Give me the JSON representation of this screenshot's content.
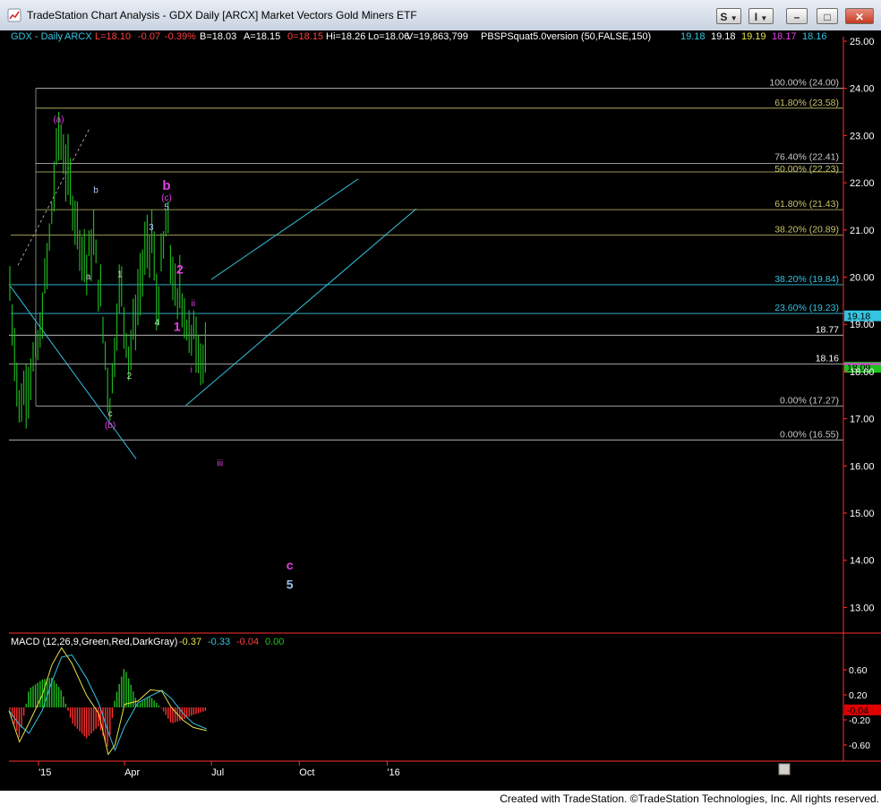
{
  "window": {
    "title": "TradeStation Chart Analysis - GDX Daily [ARCX] Market Vectors Gold Miners ETF",
    "btn_s": "S",
    "btn_i": "I"
  },
  "header": {
    "symbol": "GDX - Daily",
    "exchange": "ARCX",
    "last": "L=18.10",
    "change": "-0.07",
    "change_pct": "-0.39%",
    "bid": "B=18.03",
    "ask": "A=18.15",
    "prev": "0=18.15",
    "high": "Hi=18.26",
    "low": "Lo=18.06",
    "volume": "V=19,863,799",
    "study": "PBSPSquat5.0version (50,FALSE,150)",
    "study_values": [
      "19.18",
      "19.18",
      "19.19",
      "18.17",
      "18.16"
    ],
    "study_colors": [
      "#34c3e0",
      "#ffffff",
      "#e6e24a",
      "#e43fe4",
      "#34c3e0"
    ]
  },
  "colors": {
    "up": "#ff4040",
    "down": "#ff4040",
    "bars": "#20c020",
    "magenta": "#e43fe4",
    "cyan": "#34c3e0",
    "fib_gray": "#c8c8c8",
    "fib_olive": "#c8c46a"
  },
  "chart_data": {
    "type": "line",
    "symbol": "GDX",
    "price_axis": {
      "ticks": [
        "25.00",
        "24.00",
        "23.00",
        "22.00",
        "21.00",
        "20.00",
        "19.00",
        "18.00",
        "17.00",
        "16.00",
        "15.00",
        "14.00",
        "13.00"
      ],
      "ylim": [
        12.5,
        25.1
      ]
    },
    "time_axis": {
      "ticks": [
        "'15",
        "Apr",
        "Jul",
        "Oct",
        "'16"
      ]
    },
    "price_series": [
      {
        "t": "2014-12-01",
        "v": 20.0
      },
      {
        "t": "2014-12-12",
        "v": 17.2
      },
      {
        "t": "2014-12-20",
        "v": 17.8
      },
      {
        "t": "2015-01-02",
        "v": 18.6
      },
      {
        "t": "2015-01-12",
        "v": 20.7
      },
      {
        "t": "2015-01-22",
        "v": 23.1
      },
      {
        "t": "2015-01-30",
        "v": 22.3
      },
      {
        "t": "2015-02-10",
        "v": 21.2
      },
      {
        "t": "2015-02-20",
        "v": 20.2
      },
      {
        "t": "2015-02-27",
        "v": 20.8
      },
      {
        "t": "2015-03-05",
        "v": 19.9
      },
      {
        "t": "2015-03-17",
        "v": 17.3
      },
      {
        "t": "2015-03-27",
        "v": 19.9
      },
      {
        "t": "2015-04-06",
        "v": 18.3
      },
      {
        "t": "2015-04-20",
        "v": 20.2
      },
      {
        "t": "2015-04-30",
        "v": 20.9
      },
      {
        "t": "2015-05-05",
        "v": 19.3
      },
      {
        "t": "2015-05-15",
        "v": 21.2
      },
      {
        "t": "2015-05-26",
        "v": 19.2
      },
      {
        "t": "2015-05-29",
        "v": 19.9
      },
      {
        "t": "2015-06-05",
        "v": 19.0
      },
      {
        "t": "2015-06-10",
        "v": 18.5
      },
      {
        "t": "2015-06-12",
        "v": 19.1
      },
      {
        "t": "2015-06-19",
        "v": 18.4
      },
      {
        "t": "2015-06-26",
        "v": 18.1
      }
    ],
    "fib_levels": [
      {
        "label": "100.00% (24.00)",
        "value": 24.0,
        "color": "gray"
      },
      {
        "label": "61.80% (23.58)",
        "value": 23.58,
        "color": "olive"
      },
      {
        "label": "76.40% (22.41)",
        "value": 22.41,
        "color": "gray"
      },
      {
        "label": "50.00% (22.23)",
        "value": 22.23,
        "color": "olive"
      },
      {
        "label": "61.80% (21.43)",
        "value": 21.43,
        "color": "olive"
      },
      {
        "label": "38.20% (20.89)",
        "value": 20.89,
        "color": "olive"
      },
      {
        "label": "38.20% (19.84)",
        "value": 19.84,
        "color": "cyan"
      },
      {
        "label": "23.60% (19.23)",
        "value": 19.23,
        "color": "cyan"
      },
      {
        "label": "0.00% (17.27)",
        "value": 17.27,
        "color": "gray"
      },
      {
        "label": "0.00% (16.55)",
        "value": 16.55,
        "color": "gray"
      }
    ],
    "price_lines": [
      {
        "label": "18.77",
        "value": 18.77
      },
      {
        "label": "18.16",
        "value": 18.16
      }
    ],
    "price_markers": [
      {
        "label": "19.18",
        "value": 19.18,
        "bg": "#34c3e0",
        "fg": "#000000"
      },
      {
        "label": "18.09",
        "value": 18.09,
        "bg": "#20c020",
        "fg": "#000000"
      }
    ],
    "wave_labels": [
      {
        "text": "(a)",
        "t": "2015-01-22",
        "v": 23.28,
        "color": "magenta"
      },
      {
        "text": "b",
        "t": "2015-03-02",
        "v": 21.78,
        "color": "cyan"
      },
      {
        "text": "a",
        "t": "2015-02-22",
        "v": 19.95,
        "color": "gray"
      },
      {
        "text": "c",
        "t": "2015-03-17",
        "v": 17.05,
        "color": "gray"
      },
      {
        "text": "(b)",
        "t": "2015-03-17",
        "v": 16.8,
        "color": "magenta"
      },
      {
        "text": "1",
        "t": "2015-03-27",
        "v": 20.0,
        "color": "gray"
      },
      {
        "text": "2",
        "t": "2015-04-06",
        "v": 17.85,
        "color": "gray"
      },
      {
        "text": "3",
        "t": "2015-04-29",
        "v": 21.0,
        "color": "cyan"
      },
      {
        "text": "4",
        "t": "2015-05-05",
        "v": 18.98,
        "color": "gray"
      },
      {
        "text": "5",
        "t": "2015-05-15",
        "v": 21.42,
        "color": "cyan"
      },
      {
        "text": "(c)",
        "t": "2015-05-15",
        "v": 21.62,
        "color": "magenta"
      },
      {
        "text": "b",
        "t": "2015-05-15",
        "v": 21.85,
        "color": "magenta_big"
      },
      {
        "text": "2",
        "t": "2015-05-29",
        "v": 20.08,
        "color": "magenta_big"
      },
      {
        "text": "1",
        "t": "2015-05-26",
        "v": 18.86,
        "color": "magenta_big"
      },
      {
        "text": "ii",
        "t": "2015-06-12",
        "v": 19.38,
        "color": "magenta"
      },
      {
        "text": "i",
        "t": "2015-06-10",
        "v": 17.98,
        "color": "magenta"
      },
      {
        "text": "iii",
        "t": "2015-07-10",
        "v": 16.0,
        "color": "magenta"
      },
      {
        "text": "c",
        "t": "2015-09-21",
        "v": 13.8,
        "color": "magenta_big"
      },
      {
        "text": "5",
        "t": "2015-09-21",
        "v": 13.4,
        "color": "cyan_big"
      }
    ],
    "macd": {
      "title": "MACD (12,26,9,Green,Red,DarkGray)",
      "values": [
        "-0.37",
        "-0.33",
        "-0.04",
        "0.00"
      ],
      "value_colors": [
        "#e6e24a",
        "#34c3e0",
        "#ff4040",
        "#20c020"
      ],
      "ticks": [
        "0.60",
        "0.20",
        "-0.20",
        "-0.60"
      ],
      "ylim": [
        -0.85,
        0.95
      ],
      "marker": "-0.04"
    }
  },
  "footer": {
    "credit": "Created with TradeStation. ©TradeStation Technologies, Inc. All rights reserved."
  }
}
